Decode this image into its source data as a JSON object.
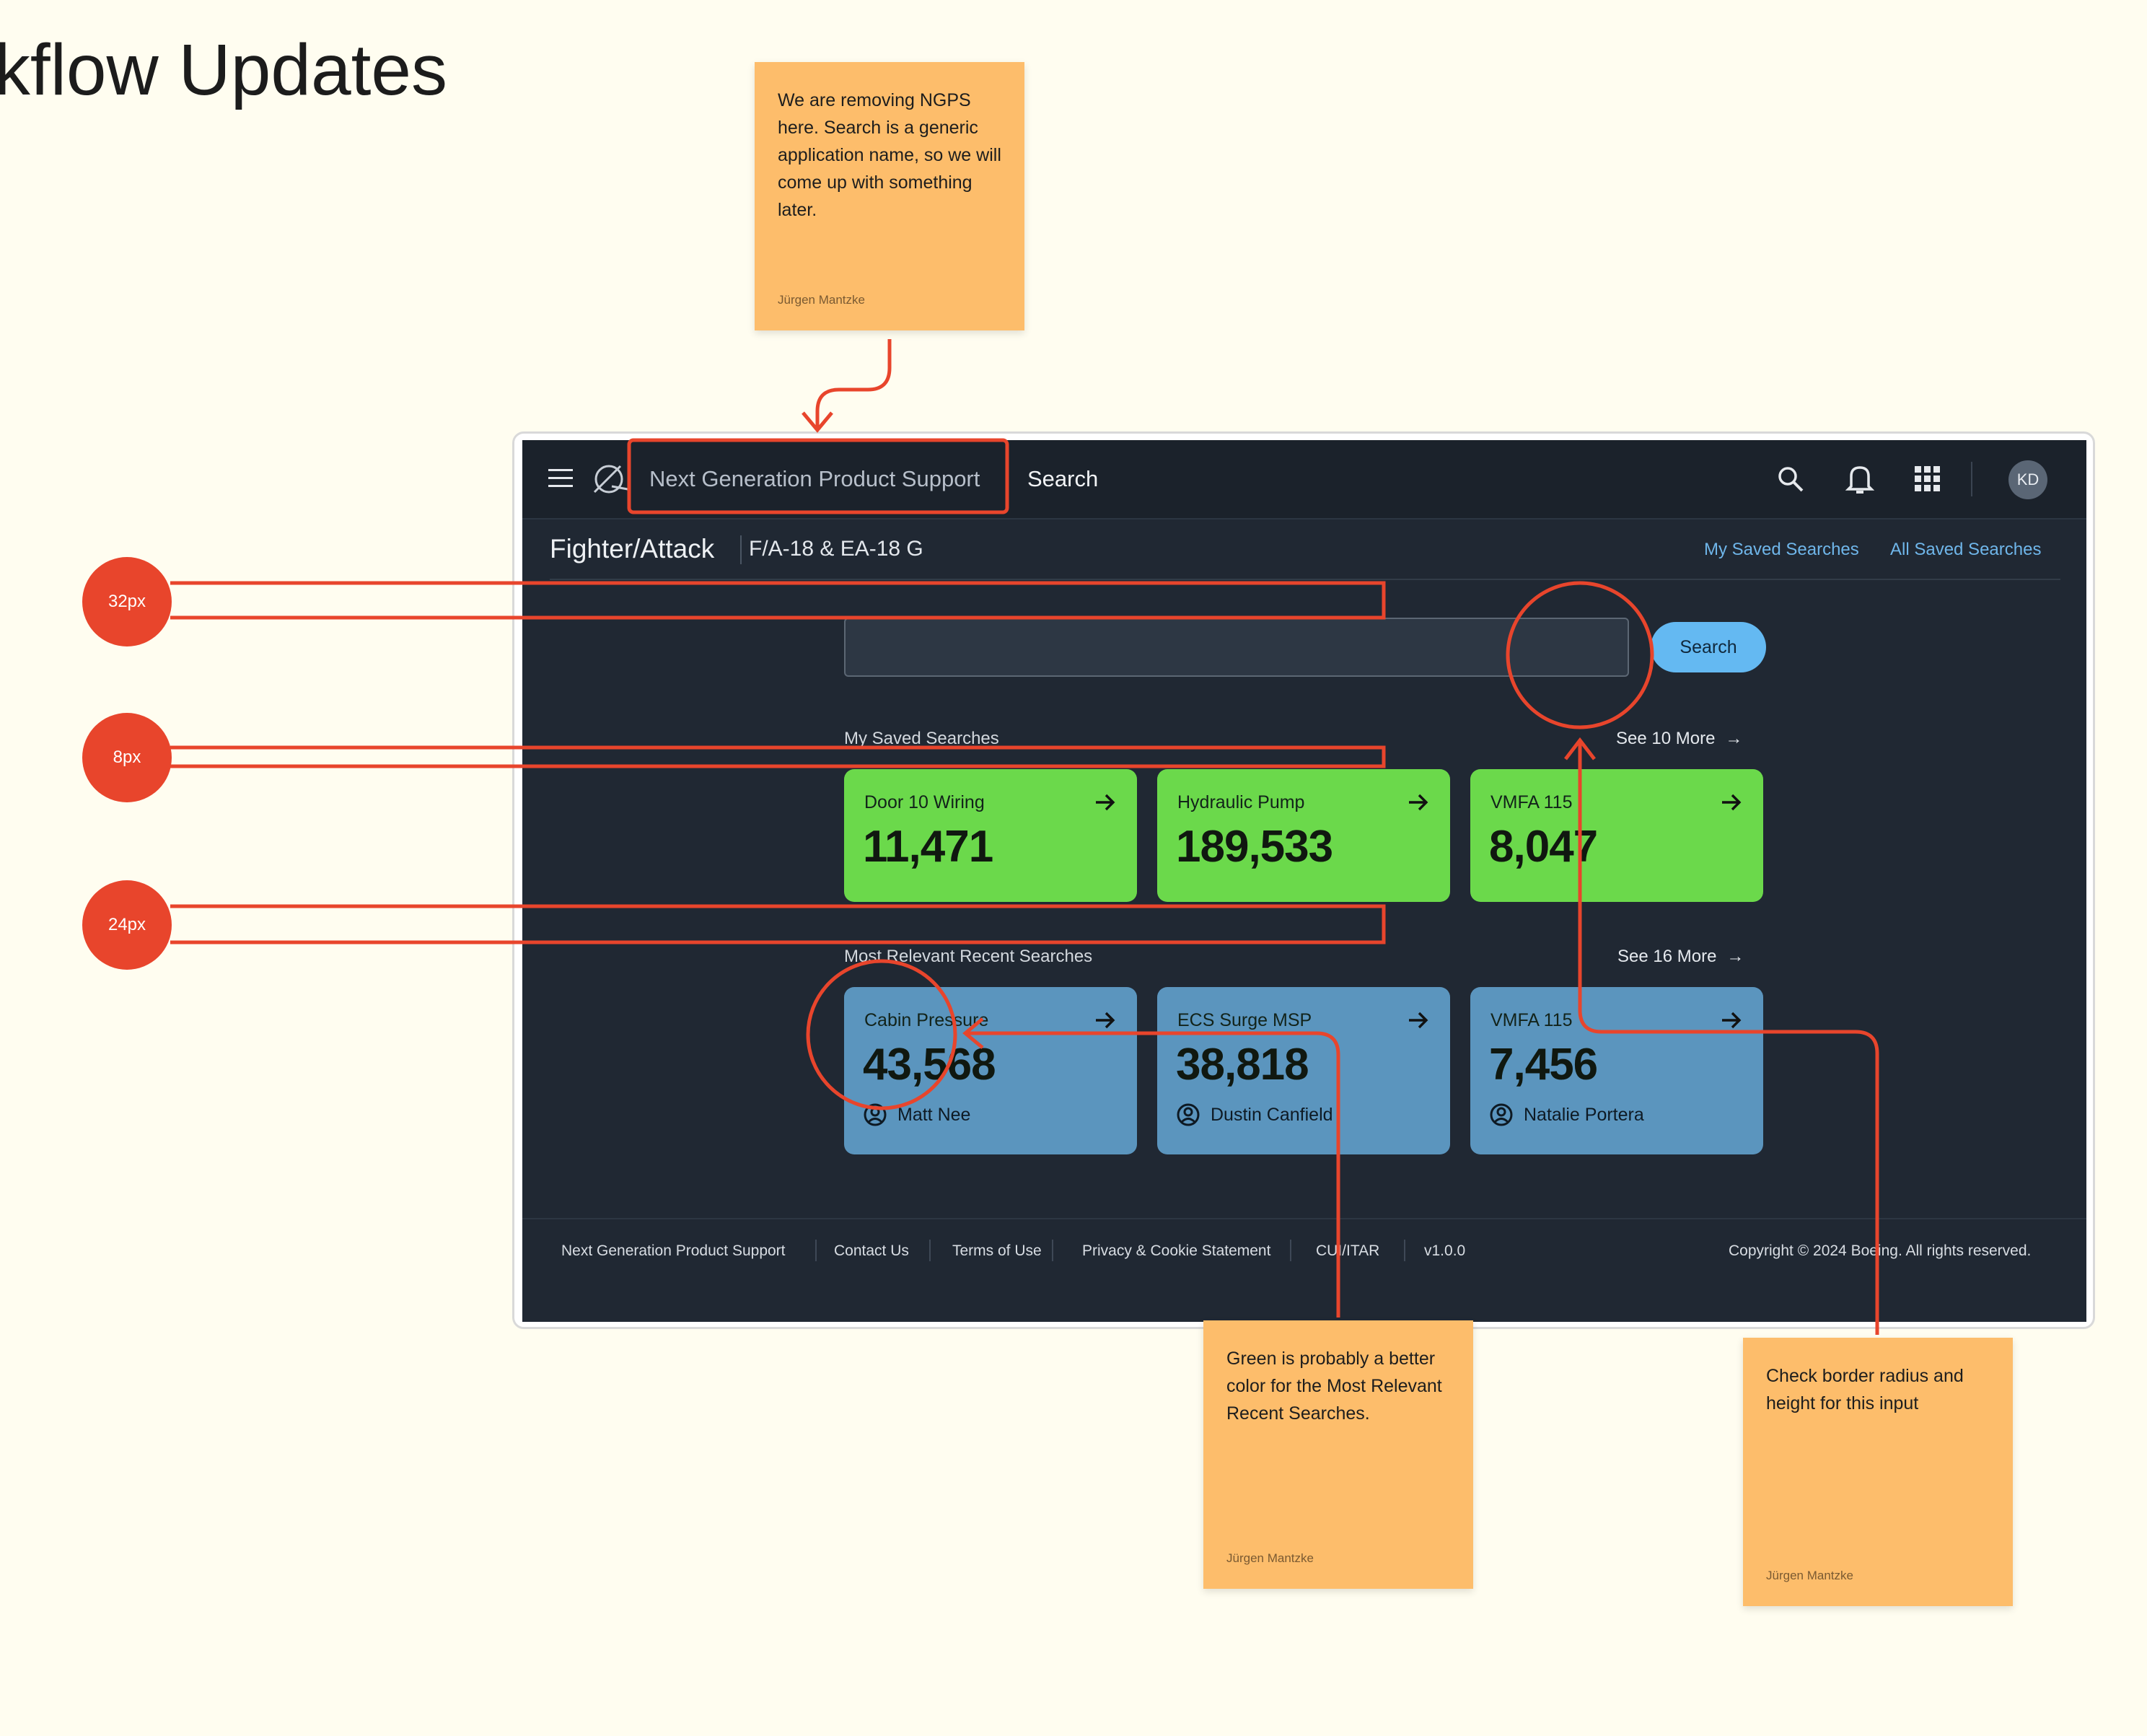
{
  "canvas": {
    "title": "kflow Updates"
  },
  "notes": [
    {
      "text": "We are removing NGPS here. Search is a generic application name, so we will come up with something later.",
      "author": "Jürgen Mantzke"
    },
    {
      "text": "Green is probably a better color for the Most Relevant Recent Searches.",
      "author": "Jürgen Mantzke"
    },
    {
      "text": "Check border radius and height for this input",
      "author": "Jürgen Mantzke"
    }
  ],
  "measurements": [
    "32px",
    "8px",
    "24px"
  ],
  "colors": {
    "annotation_red": "#e8452c",
    "sticky": "#fdbd6b",
    "app_bg": "#202833",
    "green_card": "#6bd94b",
    "blue_card": "#5b95be",
    "search_button": "#64b9f2",
    "link": "#6fb6ea"
  },
  "topbar": {
    "app_name": "Next Generation Product Support",
    "nav_search": "Search",
    "avatar_initials": "KD",
    "icons": [
      "menu-icon",
      "logo-icon",
      "search-icon",
      "bell-icon",
      "apps-grid-icon"
    ]
  },
  "subheader": {
    "title": "Fighter/Attack",
    "subtitle": "F/A-18 & EA-18 G",
    "links": [
      "My Saved Searches",
      "All Saved Searches"
    ]
  },
  "search": {
    "placeholder": "",
    "button_label": "Search"
  },
  "saved_searches": {
    "label": "My Saved Searches",
    "see_more": "See 10 More",
    "cards": [
      {
        "label": "Door 10 Wiring",
        "value": "11,471"
      },
      {
        "label": "Hydraulic Pump",
        "value": "189,533"
      },
      {
        "label": "VMFA 115",
        "value": "8,047"
      }
    ]
  },
  "recent_searches": {
    "label": "Most Relevant Recent Searches",
    "see_more": "See 16 More",
    "cards": [
      {
        "label": "Cabin Pressure",
        "value": "43,568",
        "user": "Matt Nee"
      },
      {
        "label": "ECS Surge MSP",
        "value": "38,818",
        "user": "Dustin Canfield"
      },
      {
        "label": "VMFA 115",
        "value": "7,456",
        "user": "Natalie Portera"
      }
    ]
  },
  "footer": {
    "links": [
      "Next Generation Product Support",
      "Contact Us",
      "Terms of Use",
      "Privacy & Cookie Statement",
      "CUI/ITAR",
      "v1.0.0"
    ],
    "copyright": "Copyright © 2024 Boeing. All rights reserved."
  }
}
